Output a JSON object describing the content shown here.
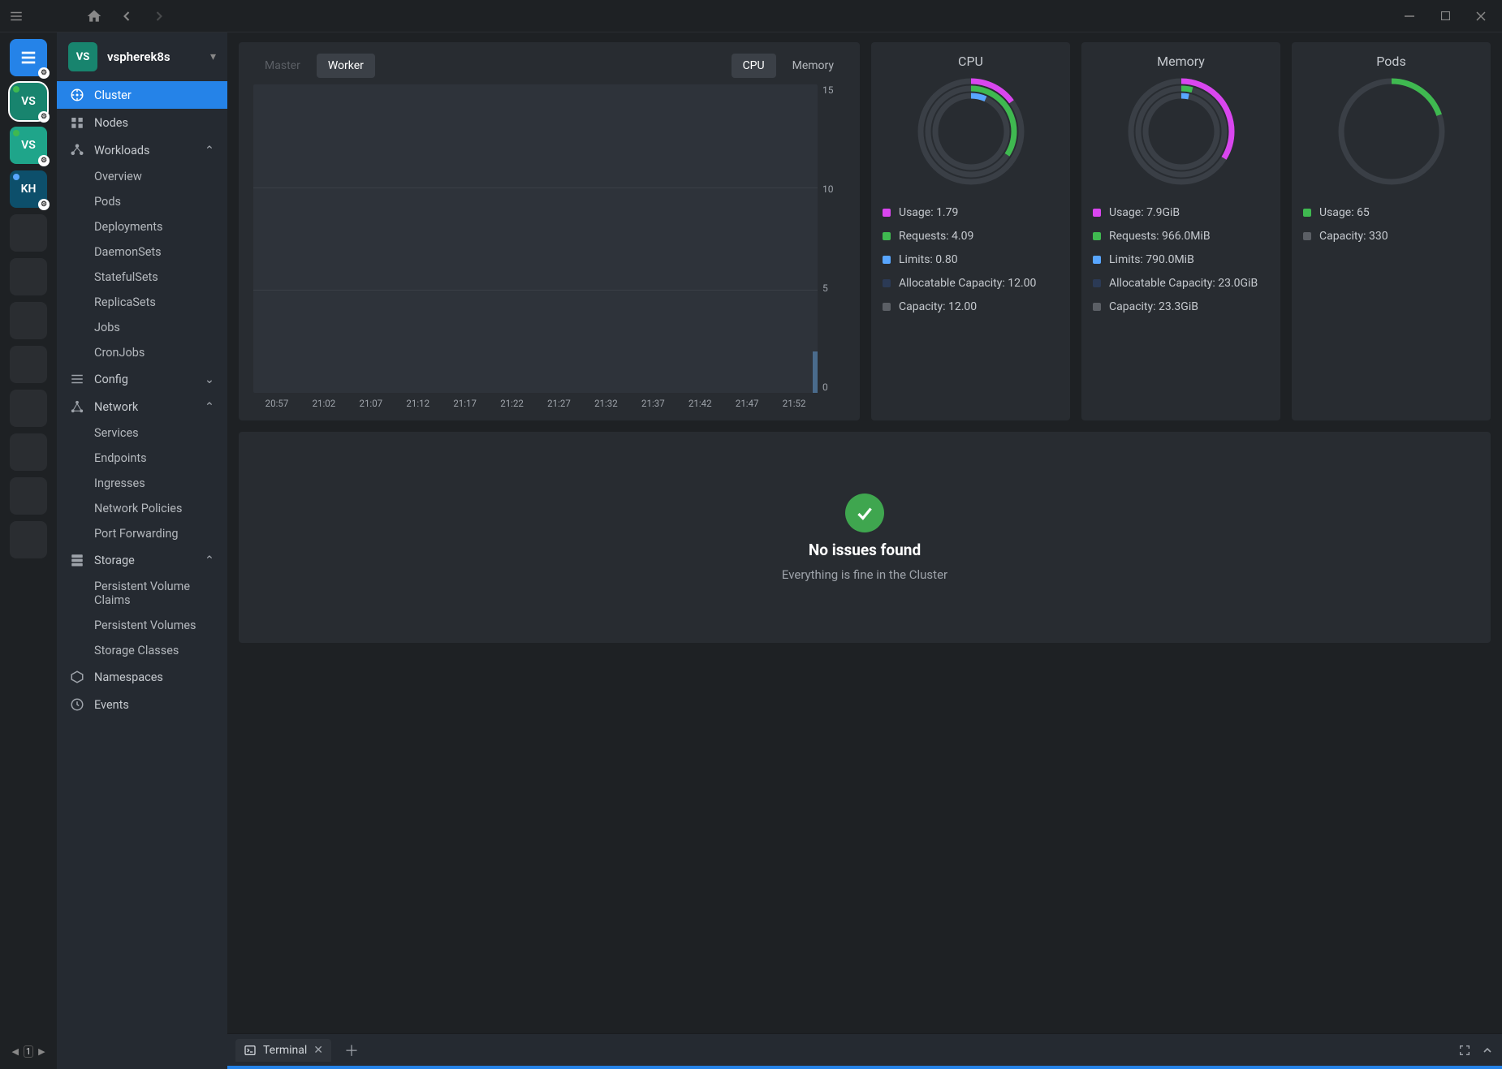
{
  "cluster": {
    "badge": "VS",
    "name": "vspherek8s"
  },
  "hotbar": {
    "catalog_label": "catalog",
    "items": [
      {
        "label": "VS",
        "kind": "active"
      },
      {
        "label": "VS",
        "kind": "vs-alt"
      },
      {
        "label": "KH",
        "kind": "kh"
      }
    ],
    "page": "1"
  },
  "sidebar": {
    "items": [
      {
        "label": "Cluster"
      },
      {
        "label": "Nodes"
      },
      {
        "label": "Workloads"
      },
      {
        "label": "Overview"
      },
      {
        "label": "Pods"
      },
      {
        "label": "Deployments"
      },
      {
        "label": "DaemonSets"
      },
      {
        "label": "StatefulSets"
      },
      {
        "label": "ReplicaSets"
      },
      {
        "label": "Jobs"
      },
      {
        "label": "CronJobs"
      },
      {
        "label": "Config"
      },
      {
        "label": "Network"
      },
      {
        "label": "Services"
      },
      {
        "label": "Endpoints"
      },
      {
        "label": "Ingresses"
      },
      {
        "label": "Network Policies"
      },
      {
        "label": "Port Forwarding"
      },
      {
        "label": "Storage"
      },
      {
        "label": "Persistent Volume Claims"
      },
      {
        "label": "Persistent Volumes"
      },
      {
        "label": "Storage Classes"
      },
      {
        "label": "Namespaces"
      },
      {
        "label": "Events"
      }
    ]
  },
  "chart": {
    "tabs": {
      "master": "Master",
      "worker": "Worker",
      "cpu": "CPU",
      "memory": "Memory"
    }
  },
  "chart_data": {
    "type": "bar",
    "title": "",
    "xlabel": "",
    "ylabel": "",
    "ylim": [
      0,
      15
    ],
    "yticks": [
      15,
      10,
      5,
      0
    ],
    "categories": [
      "20:57",
      "21:02",
      "21:07",
      "21:12",
      "21:17",
      "21:22",
      "21:27",
      "21:32",
      "21:37",
      "21:42",
      "21:47",
      "21:52"
    ],
    "values": [
      0,
      0,
      0,
      0,
      0,
      0,
      0,
      0,
      0,
      0,
      0,
      2
    ]
  },
  "metrics_cpu": {
    "title": "CPU",
    "colors": {
      "usage": "#d946ef",
      "requests": "#3fb950",
      "limits": "#58a6ff",
      "alloc": "#2b3a55",
      "capacity": "#5b5f65"
    },
    "legend": [
      {
        "key": "usage",
        "label": "Usage: 1.79"
      },
      {
        "key": "requests",
        "label": "Requests: 4.09"
      },
      {
        "key": "limits",
        "label": "Limits: 0.80"
      },
      {
        "key": "alloc",
        "label": "Allocatable Capacity: 12.00"
      },
      {
        "key": "capacity",
        "label": "Capacity: 12.00"
      }
    ],
    "arcs": {
      "usage_frac": 0.149,
      "requests_frac": 0.341,
      "limits_frac": 0.067
    }
  },
  "metrics_mem": {
    "title": "Memory",
    "colors": {
      "usage": "#d946ef",
      "requests": "#3fb950",
      "limits": "#58a6ff",
      "alloc": "#2b3a55",
      "capacity": "#5b5f65"
    },
    "legend": [
      {
        "key": "usage",
        "label": "Usage: 7.9GiB"
      },
      {
        "key": "requests",
        "label": "Requests: 966.0MiB"
      },
      {
        "key": "limits",
        "label": "Limits: 790.0MiB"
      },
      {
        "key": "alloc",
        "label": "Allocatable Capacity: 23.0GiB"
      },
      {
        "key": "capacity",
        "label": "Capacity: 23.3GiB"
      }
    ],
    "arcs": {
      "usage_frac": 0.339,
      "requests_frac": 0.041,
      "limits_frac": 0.033
    }
  },
  "metrics_pods": {
    "title": "Pods",
    "colors": {
      "usage": "#3fb950",
      "capacity": "#5b5f65"
    },
    "legend": [
      {
        "key": "usage",
        "label": "Usage: 65"
      },
      {
        "key": "capacity",
        "label": "Capacity: 330"
      }
    ],
    "arcs": {
      "usage_frac": 0.197
    }
  },
  "issues": {
    "title": "No issues found",
    "sub": "Everything is fine in the Cluster"
  },
  "terminal": {
    "label": "Terminal"
  }
}
